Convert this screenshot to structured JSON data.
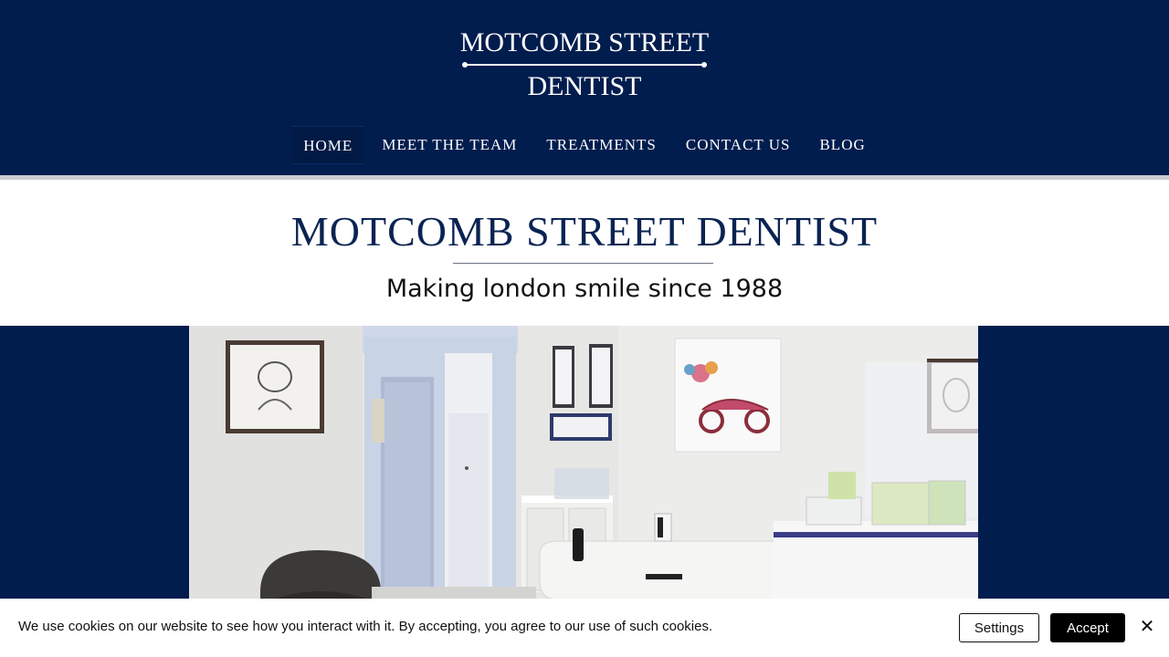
{
  "header": {
    "logo_top": "MOTCOMB STREET",
    "logo_bottom": "DENTIST",
    "background": "#001d4e"
  },
  "nav": {
    "items": [
      {
        "label": "HOME",
        "active": true
      },
      {
        "label": "MEET THE TEAM",
        "active": false
      },
      {
        "label": "TREATMENTS",
        "active": false
      },
      {
        "label": "CONTACT US",
        "active": false
      },
      {
        "label": "BLOG",
        "active": false
      }
    ]
  },
  "hero": {
    "title": "MOTCOMB STREET DENTIST",
    "subtitle": "Making london smile since 1988",
    "title_color": "#0a2352"
  },
  "photo": {
    "subject": "reception-room-photo"
  },
  "cookie": {
    "text": "We use cookies on our website to see how you interact with it. By accepting, you agree to our use of such cookies.",
    "settings_label": "Settings",
    "accept_label": "Accept",
    "close_icon": "close-icon"
  }
}
